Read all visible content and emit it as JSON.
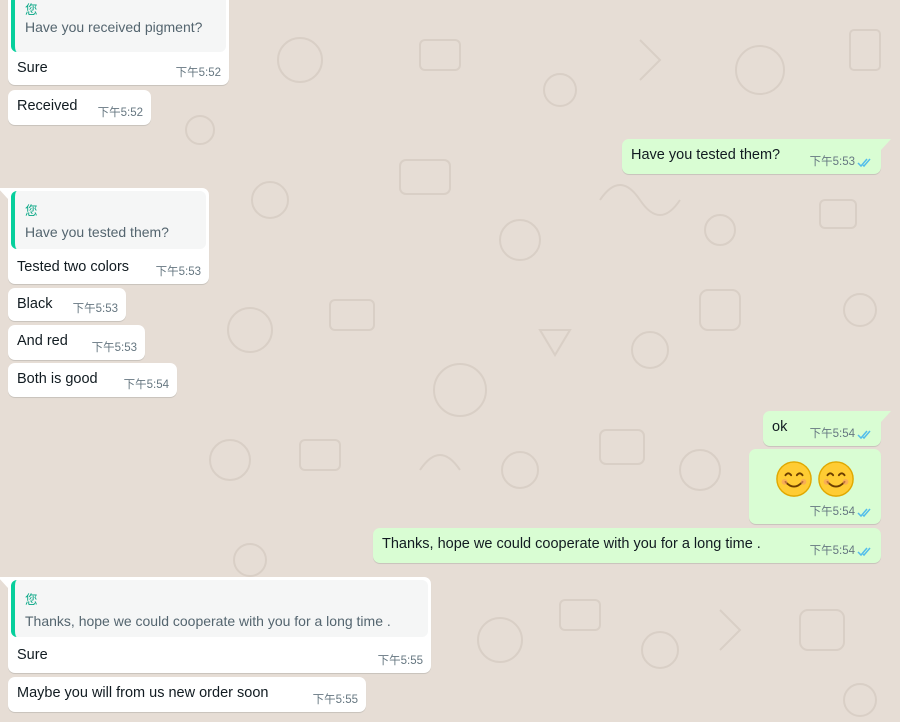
{
  "colors": {
    "background": "#e6ddd5",
    "incoming_bubble": "#ffffff",
    "outgoing_bubble": "#d9fdd3",
    "quote_accent": "#06cf9c",
    "read_ticks": "#53bdeb",
    "timestamp": "#667781"
  },
  "messages": [
    {
      "direction": "in",
      "reply_to": {
        "author": "您",
        "text": "Have you received pigment?"
      },
      "text": "Sure",
      "time": "下午5:52"
    },
    {
      "direction": "in",
      "text": "Received",
      "time": "下午5:52"
    },
    {
      "direction": "out",
      "text": "Have you tested them?",
      "time": "下午5:53",
      "status_icon": "read-double-check-icon"
    },
    {
      "direction": "in",
      "reply_to": {
        "author": "您",
        "text": "Have you tested them?"
      },
      "text": "Tested two colors",
      "time": "下午5:53"
    },
    {
      "direction": "in",
      "text": "Black",
      "time": "下午5:53"
    },
    {
      "direction": "in",
      "text": "And red",
      "time": "下午5:53"
    },
    {
      "direction": "in",
      "text": "Both is good",
      "time": "下午5:54"
    },
    {
      "direction": "out",
      "text": "ok",
      "time": "下午5:54",
      "status_icon": "read-double-check-icon"
    },
    {
      "direction": "out",
      "emojis": [
        "smiling-face-icon",
        "smiling-face-icon"
      ],
      "time": "下午5:54",
      "status_icon": "read-double-check-icon"
    },
    {
      "direction": "out",
      "text": "Thanks, hope we could cooperate with you for a long time .",
      "time": "下午5:54",
      "status_icon": "read-double-check-icon"
    },
    {
      "direction": "in",
      "reply_to": {
        "author": "您",
        "text": "Thanks, hope we could cooperate with you for a long time ."
      },
      "text": "Sure",
      "time": "下午5:55"
    },
    {
      "direction": "in",
      "text": "Maybe you will from us new order soon",
      "time": "下午5:55"
    }
  ]
}
